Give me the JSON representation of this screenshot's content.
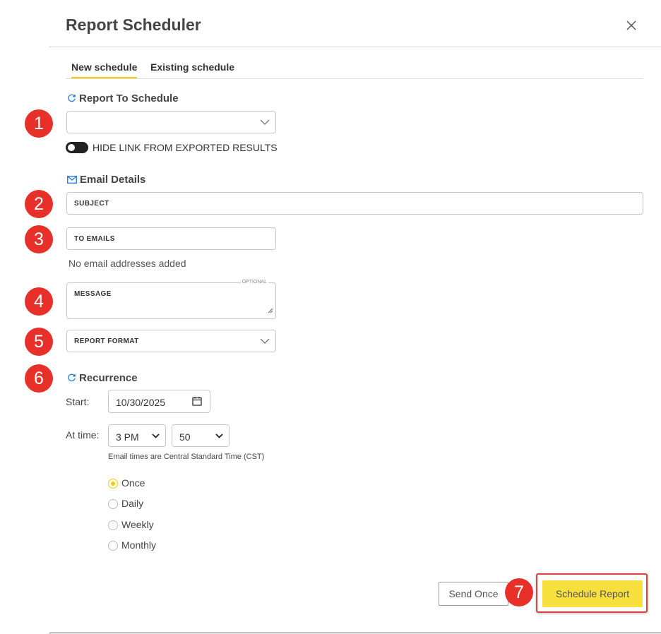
{
  "dialog": {
    "title": "Report Scheduler"
  },
  "tabs": [
    {
      "label": "New schedule"
    },
    {
      "label": "Existing schedule"
    }
  ],
  "report_section": {
    "heading": "Report To Schedule",
    "select_value": "",
    "toggle_label": "HIDE LINK FROM EXPORTED RESULTS"
  },
  "email_section": {
    "heading": "Email Details",
    "subject_placeholder": "SUBJECT",
    "to_emails_placeholder": "TO EMAILS",
    "no_emails_text": "No email addresses added",
    "message_placeholder": "MESSAGE",
    "message_optional_label": "OPTIONAL",
    "format_placeholder": "REPORT FORMAT"
  },
  "recurrence": {
    "heading": "Recurrence",
    "start_label": "Start:",
    "start_date": "10/30/2025",
    "time_label": "At time:",
    "hour": "3 PM",
    "minute": "50",
    "tz_note": "Email times are Central Standard Time (CST)",
    "options": [
      {
        "label": "Once",
        "selected": true
      },
      {
        "label": "Daily",
        "selected": false
      },
      {
        "label": "Weekly",
        "selected": false
      },
      {
        "label": "Monthly",
        "selected": false
      }
    ]
  },
  "actions": {
    "send_once": "Send Once",
    "schedule_report": "Schedule Report"
  },
  "annotations": [
    "1",
    "2",
    "3",
    "4",
    "5",
    "6",
    "7"
  ],
  "colors": {
    "accent": "#f2cc0c",
    "badge": "#e8302a",
    "highlight_border": "#e04040",
    "icon_blue": "#1f7bd8"
  }
}
